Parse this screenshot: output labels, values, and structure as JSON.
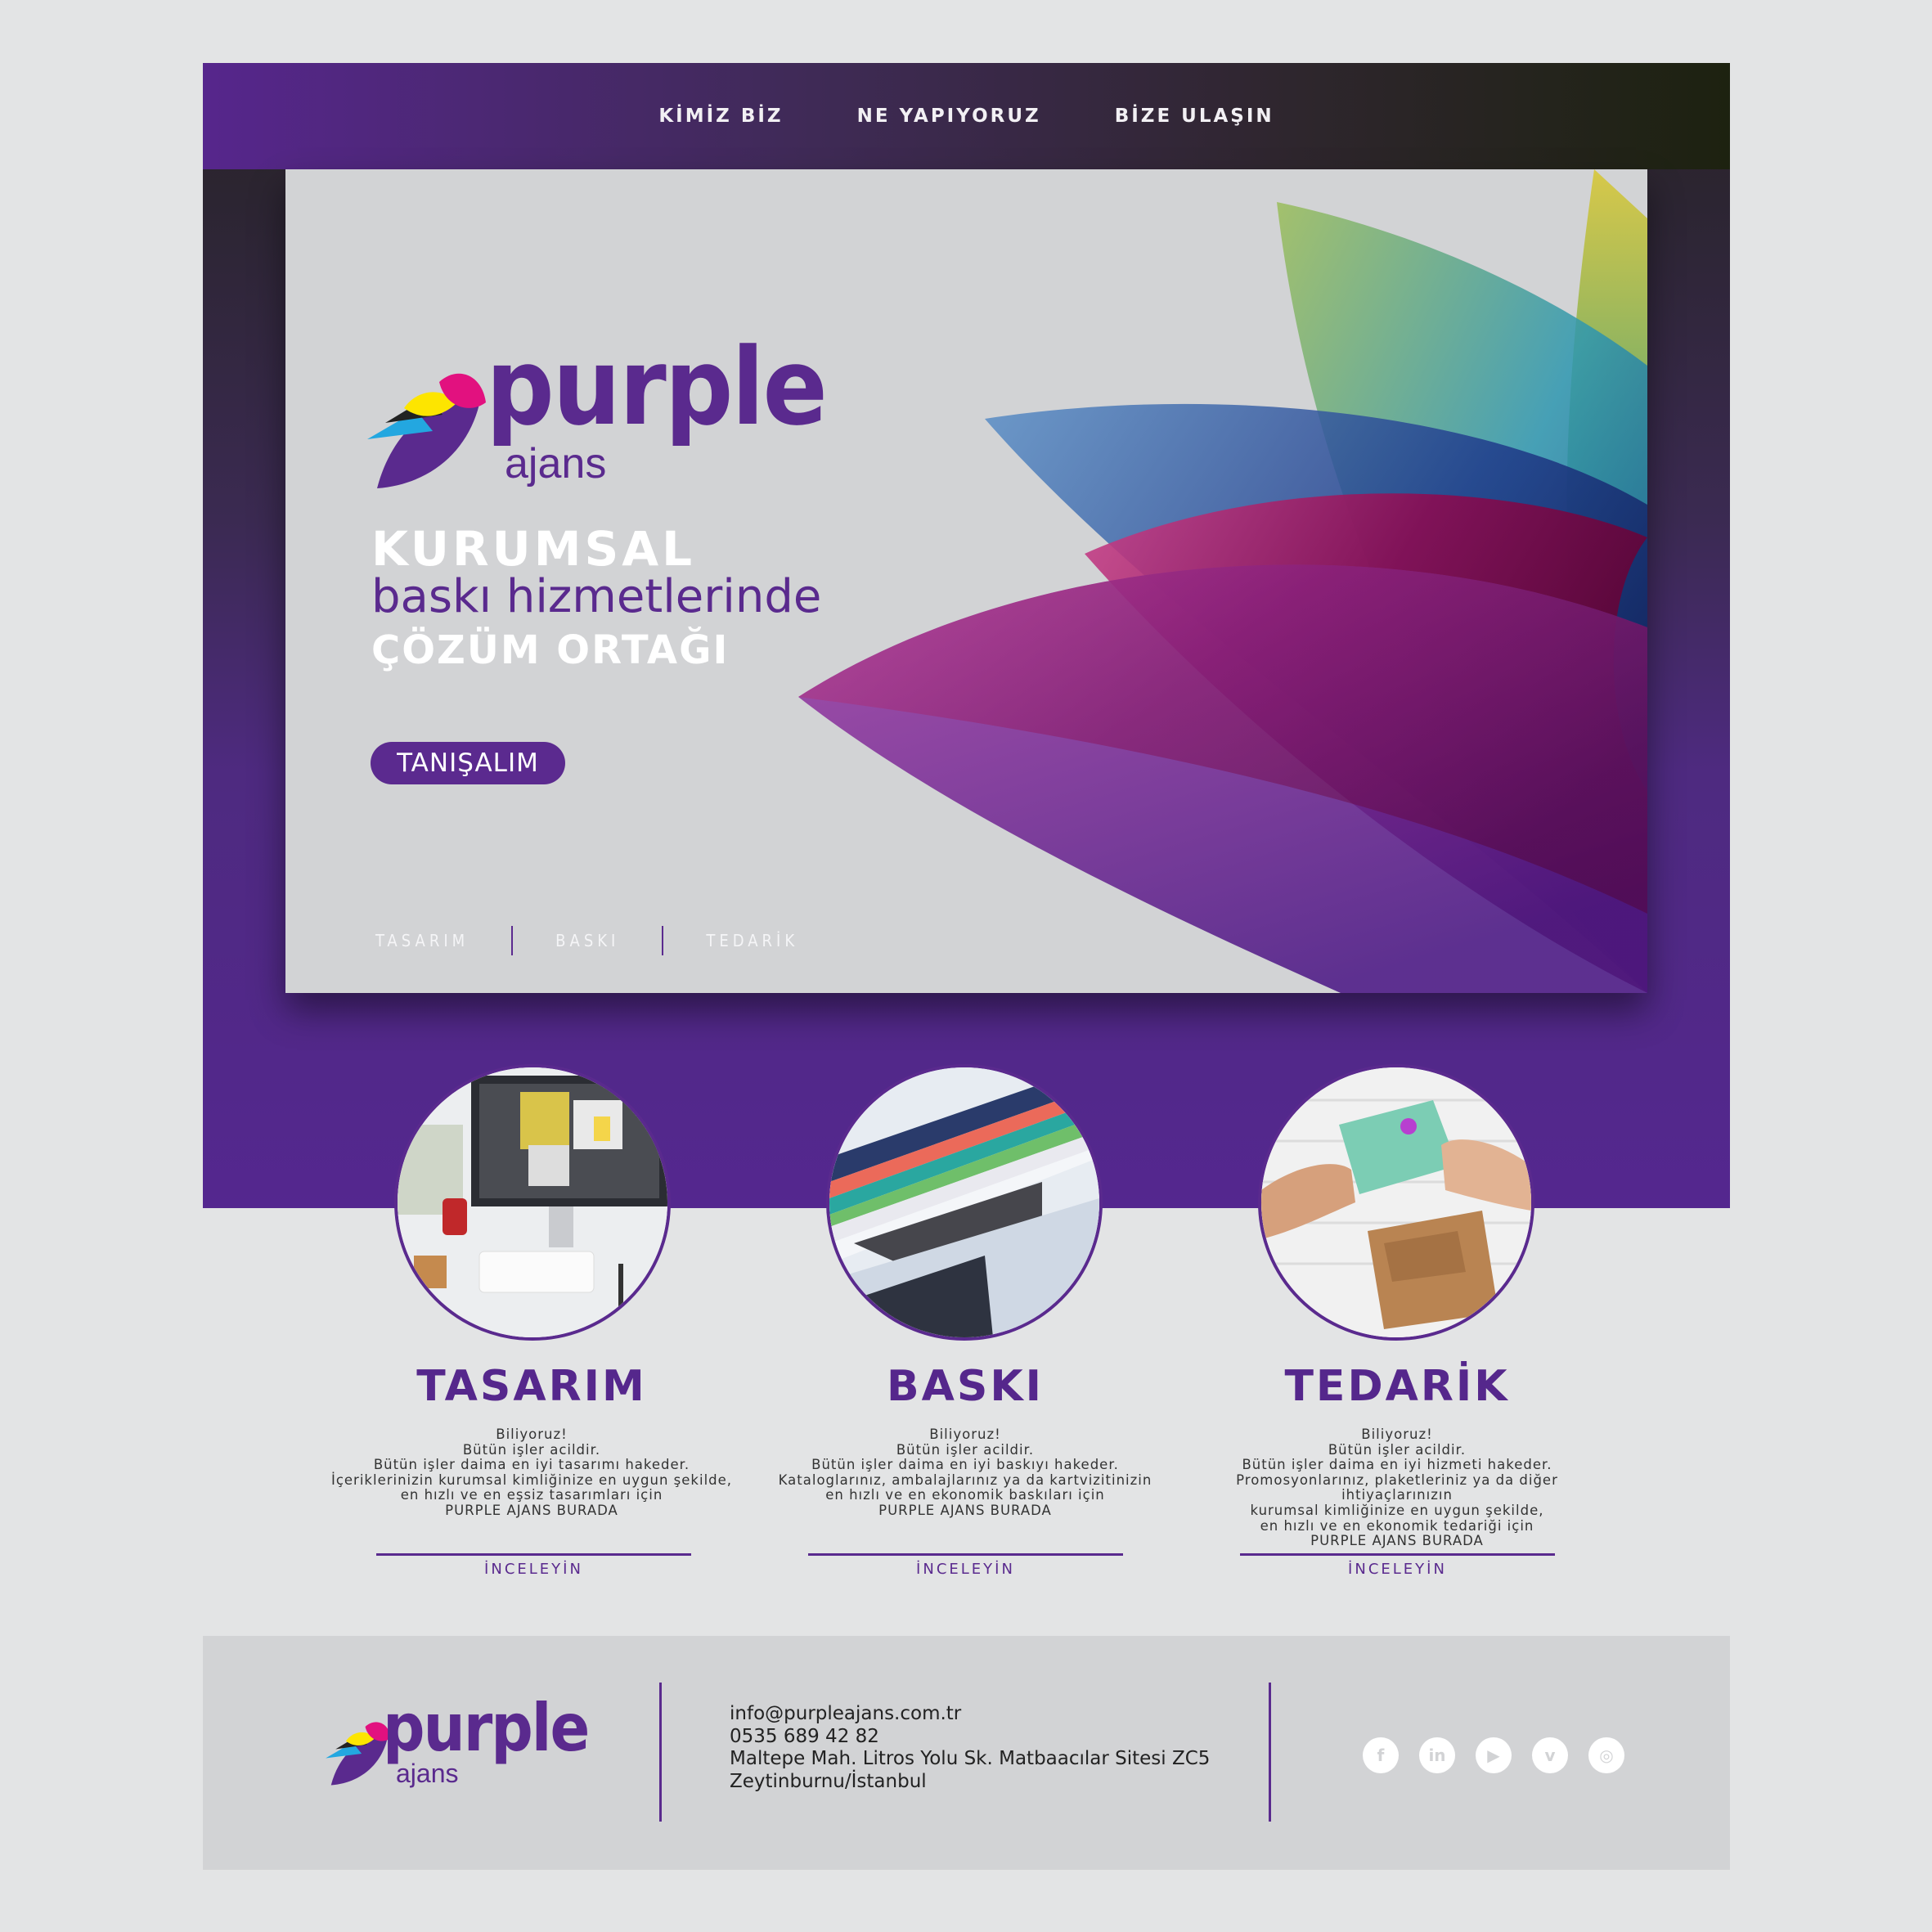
{
  "nav": {
    "items": [
      "KİMİZ BİZ",
      "NE YAPIYORUZ",
      "BİZE ULAŞIN"
    ]
  },
  "brand": {
    "name": "purple",
    "sub": "ajans",
    "colors": {
      "primary": "#5a2a8e",
      "cyan": "#23a7e0",
      "magenta": "#e2117f",
      "yellow": "#fde500",
      "black": "#222222"
    }
  },
  "hero": {
    "line1": "KURUMSAL",
    "line2": "baskı hizmetlerinde",
    "line3": "ÇÖZÜM ORTAĞI",
    "cta": "TANIŞALIM",
    "subnav": [
      "TASARIM",
      "BASKI",
      "TEDARİK"
    ]
  },
  "cards": [
    {
      "title": "TASARIM",
      "image": "designer-workstation-image",
      "lines": [
        "Biliyoruz!",
        "Bütün işler acildir.",
        "Bütün işler daima en iyi tasarımı hakeder.",
        "İçeriklerinizin kurumsal kimliğinize en uygun şekilde,",
        "en hızlı ve en eşsiz tasarımları için",
        "PURPLE AJANS BURADA"
      ],
      "link": "İNCELEYİN"
    },
    {
      "title": "BASKI",
      "image": "printed-catalogs-image",
      "lines": [
        "Biliyoruz!",
        "Bütün işler acildir.",
        "Bütün işler daima en iyi baskıyı hakeder.",
        "Kataloglarınız, ambalajlarınız ya da kartvizitinizin",
        "en hızlı ve en ekonomik baskıları için",
        "PURPLE AJANS BURADA"
      ],
      "link": "İNCELEYİN"
    },
    {
      "title": "TEDARİK",
      "image": "gift-exchange-image",
      "lines": [
        "Biliyoruz!",
        "Bütün işler acildir.",
        "Bütün işler daima en iyi hizmeti hakeder.",
        "Promosyonlarınız, plaketleriniz ya da diğer ihtiyaçlarınızın",
        "kurumsal kimliğinize en uygun şekilde,",
        "en hızlı ve en ekonomik tedariği için",
        "PURPLE AJANS BURADA"
      ],
      "link": "İNCELEYİN"
    }
  ],
  "footer": {
    "email": "info@purpleajans.com.tr",
    "phone": "0535 689 42 82",
    "address1": "Maltepe Mah. Litros Yolu Sk. Matbaacılar Sitesi ZC5",
    "address2": "Zeytinburnu/İstanbul",
    "socials": [
      {
        "name": "facebook-icon",
        "glyph": "f"
      },
      {
        "name": "linkedin-icon",
        "glyph": "in"
      },
      {
        "name": "youtube-icon",
        "glyph": "▶"
      },
      {
        "name": "vimeo-icon",
        "glyph": "v"
      },
      {
        "name": "instagram-icon",
        "glyph": "◎"
      }
    ]
  }
}
